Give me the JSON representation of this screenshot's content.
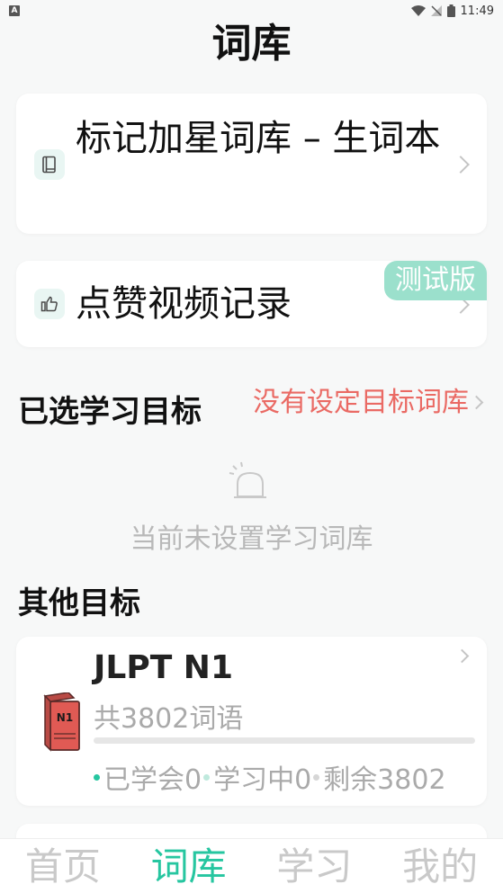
{
  "status_bar": {
    "left_icon": "A",
    "time": "11:49",
    "battery_label": "1"
  },
  "title": "词库",
  "star_card": {
    "icon": "book-icon",
    "label": "标记加星词库 – 生词本"
  },
  "like_card": {
    "icon": "thumbs-up-icon",
    "label": "点赞视频记录",
    "badge": "测试版"
  },
  "selected_section": {
    "title": "已选学习目标",
    "action": "没有设定目标词库",
    "empty_text": "当前未设置学习词库"
  },
  "other_section": {
    "title": "其他目标"
  },
  "n1_card": {
    "title": "JLPT N1",
    "book_label": "N1",
    "count": "共3802词语",
    "progress": 0,
    "learned": "已学会0",
    "learning": "学习中0",
    "remaining": "剩余3802"
  },
  "colors": {
    "accent": "#26c6a0",
    "warning": "#ea6a64",
    "badge": "#9be0cc"
  },
  "nav": {
    "items": [
      {
        "label": "首页"
      },
      {
        "label": "词库"
      },
      {
        "label": "学习"
      },
      {
        "label": "我的"
      }
    ],
    "active_index": 1
  }
}
